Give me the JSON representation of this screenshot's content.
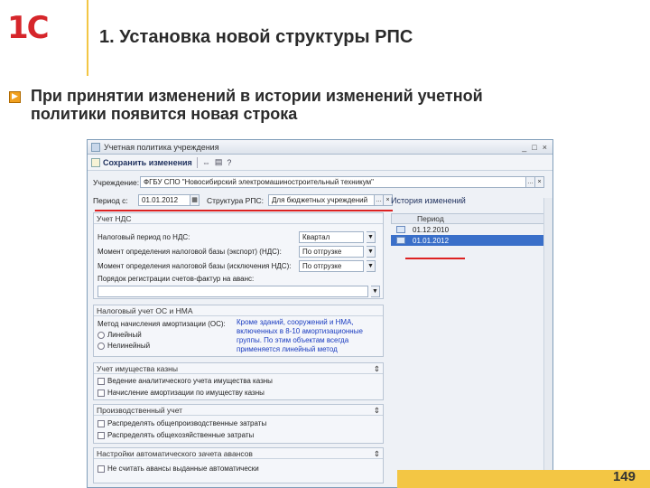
{
  "slide": {
    "logo_text": "1С",
    "title": "1. Установка новой структуры РПС",
    "lead_text": "При принятии изменений в истории изменений учетной политики появится новая строка",
    "page_number": "149"
  },
  "window": {
    "title": "Учетная политика учреждения",
    "buttons": [
      "_",
      "□",
      "×"
    ]
  },
  "toolbar": {
    "save_label": "Сохранить изменения",
    "icons": [
      "link-icon",
      "print-icon",
      "help-icon"
    ]
  },
  "form": {
    "org_label": "Учреждение:",
    "org_value": "ФГБУ СПО \"Новосибирский электромашиностроительный техникум\"",
    "period_label": "Период с:",
    "period_value": "01.01.2012",
    "structure_label": "Структура РПС:",
    "structure_value": "Для бюджетных учреждений"
  },
  "vat_group": {
    "title": "Учет НДС",
    "rows": [
      {
        "label": "Налоговый период по НДС:",
        "value": "Квартал"
      },
      {
        "label": "Момент определения налоговой базы (экспорт) (НДС):",
        "value": "По отгрузке"
      },
      {
        "label": "Момент определения налоговой базы (исключения НДС):",
        "value": "По отгрузке"
      }
    ],
    "invoice_label": "Порядок регистрации счетов-фактур на аванс:"
  },
  "tax_group": {
    "title": "Налоговый учет ОС и НМА",
    "method_label": "Метод начисления амортизации (ОС):",
    "options": [
      "Линейный",
      "Нелинейный"
    ],
    "note": "Кроме зданий, сооружений и НМА, включенных в 8-10 амортизационные группы. По этим объектам всегда применяется линейный метод"
  },
  "property_group": {
    "title": "Учет имущества казны",
    "items": [
      "Ведение аналитического учета имущества казны",
      "Начисление амортизации по имуществу казны"
    ]
  },
  "production_group": {
    "title": "Производственный учет",
    "items": [
      "Распределять общепроизводственные затраты",
      "Распределять общехозяйственные затраты"
    ]
  },
  "advance_group": {
    "title": "Настройки автоматического зачета авансов",
    "items": [
      "Не считать авансы выданные автоматически"
    ]
  },
  "history": {
    "title": "История изменений",
    "column": "Период",
    "rows": [
      {
        "date": "01.12.2010",
        "selected": false
      },
      {
        "date": "01.01.2012",
        "selected": true
      }
    ]
  },
  "colors": {
    "accent_yellow": "#f3c644",
    "logo_red": "#d6262b",
    "selection_blue": "#3a6fc9",
    "highlight_red": "#dd2222"
  }
}
